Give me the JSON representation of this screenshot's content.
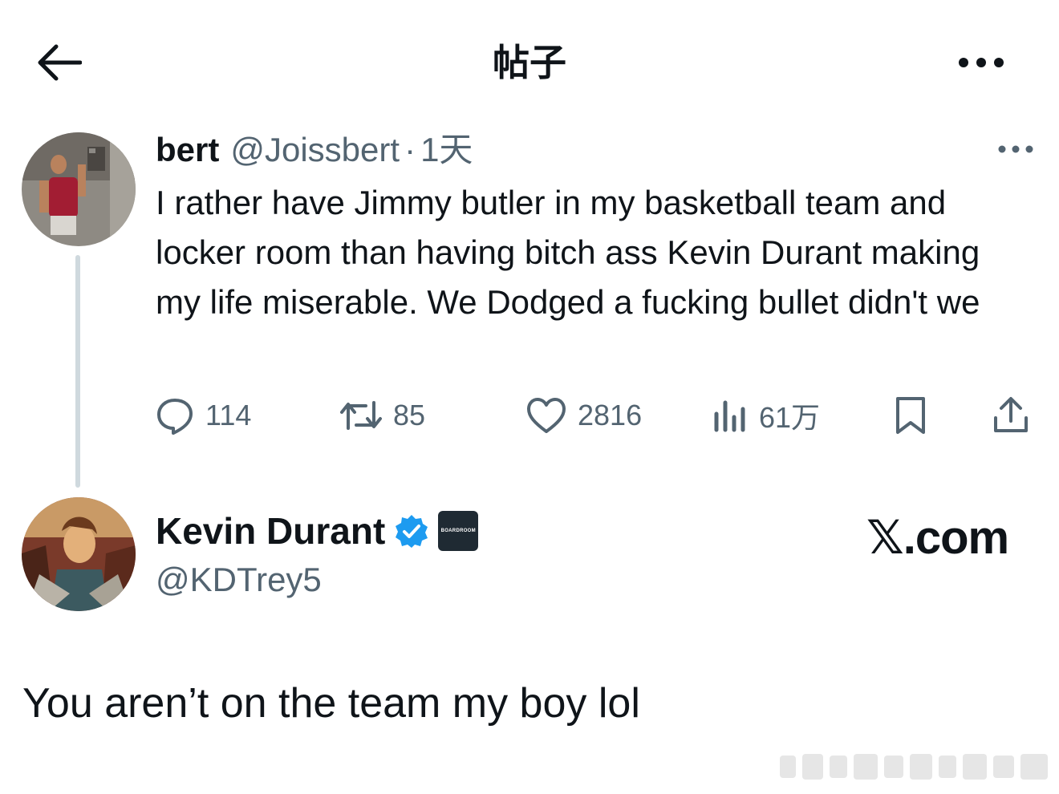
{
  "header": {
    "title": "帖子",
    "back_icon": "arrow-left-icon",
    "more_icon": "more-horizontal-icon"
  },
  "tweet": {
    "author_name": "bert",
    "author_handle": "@Joissbert",
    "separator": "·",
    "timestamp": "1天",
    "text": "I rather have Jimmy butler in my basketball team and locker room than having bitch ass Kevin Durant making my life miserable. We Dodged a fucking bullet didn't we",
    "actions": {
      "replies": "114",
      "retweets": "85",
      "likes": "2816",
      "views": "61万"
    }
  },
  "reply": {
    "author_name": "Kevin Durant",
    "author_handle": "@KDTrey5",
    "affiliate_badge": "BOARDROOM",
    "brand": "𝕏.com",
    "text": "You aren’t on the team my boy lol"
  },
  "colors": {
    "text": "#0f1419",
    "secondary": "#536471",
    "verified": "#1d9bf0",
    "line": "#cfd9de"
  }
}
